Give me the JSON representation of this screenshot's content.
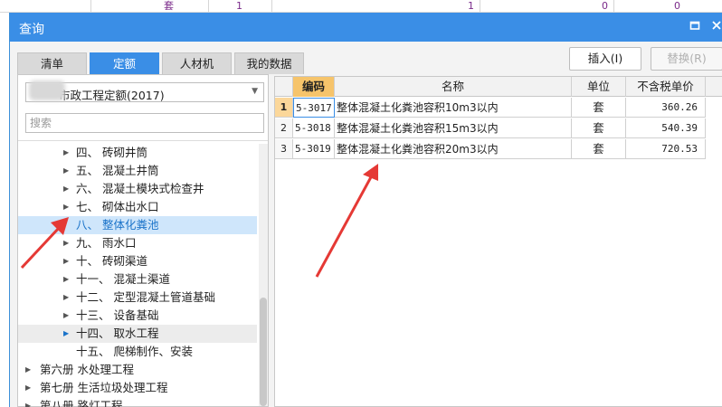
{
  "background": {
    "cells": [
      "套",
      "1",
      "1",
      "0",
      "0"
    ]
  },
  "window": {
    "title": "查询",
    "maximize_icon": "maximize-icon",
    "close_icon": "close-icon"
  },
  "tabs": [
    {
      "label": "清单",
      "active": false
    },
    {
      "label": "定额",
      "active": true
    },
    {
      "label": "人材机",
      "active": false
    },
    {
      "label": "我的数据",
      "active": false
    }
  ],
  "quota_select": {
    "value": "市政工程定额(2017)"
  },
  "search": {
    "placeholder": "搜索"
  },
  "tree": [
    {
      "label": "四、 砖砌井筒",
      "level": 1,
      "expandable": true,
      "state": ""
    },
    {
      "label": "五、 混凝土井筒",
      "level": 1,
      "expandable": true,
      "state": ""
    },
    {
      "label": "六、 混凝土模块式检查井",
      "level": 1,
      "expandable": true,
      "state": ""
    },
    {
      "label": "七、 砌体出水口",
      "level": 1,
      "expandable": true,
      "state": ""
    },
    {
      "label": "八、 整体化粪池",
      "level": 1,
      "expandable": false,
      "state": "selected"
    },
    {
      "label": "九、 雨水口",
      "level": 1,
      "expandable": true,
      "state": ""
    },
    {
      "label": "十、 砖砌渠道",
      "level": 1,
      "expandable": true,
      "state": ""
    },
    {
      "label": "十一、 混凝土渠道",
      "level": 1,
      "expandable": true,
      "state": ""
    },
    {
      "label": "十二、 定型混凝土管道基础",
      "level": 1,
      "expandable": true,
      "state": ""
    },
    {
      "label": "十三、 设备基础",
      "level": 1,
      "expandable": true,
      "state": ""
    },
    {
      "label": "十四、 取水工程",
      "level": 1,
      "expandable": true,
      "state": "hover"
    },
    {
      "label": "十五、 爬梯制作、安装",
      "level": 1,
      "expandable": false,
      "state": ""
    },
    {
      "label": "第六册 水处理工程",
      "level": 0,
      "expandable": true,
      "state": ""
    },
    {
      "label": "第七册 生活垃圾处理工程",
      "level": 0,
      "expandable": true,
      "state": ""
    },
    {
      "label": "第八册 路灯工程",
      "level": 0,
      "expandable": true,
      "state": ""
    }
  ],
  "buttons": {
    "insert": "插入(I)",
    "replace": "替换(R)"
  },
  "grid": {
    "headers": {
      "code": "编码",
      "name": "名称",
      "unit": "单位",
      "price": "不含税单价"
    },
    "rows": [
      {
        "num": "1",
        "code": "5-3017",
        "name": "整体混凝土化粪池容积10m3以内",
        "unit": "套",
        "price": "360.26"
      },
      {
        "num": "2",
        "code": "5-3018",
        "name": "整体混凝土化粪池容积15m3以内",
        "unit": "套",
        "price": "540.39"
      },
      {
        "num": "3",
        "code": "5-3019",
        "name": "整体混凝土化粪池容积20m3以内",
        "unit": "套",
        "price": "720.53"
      }
    ]
  },
  "annotation_color": "#e53935"
}
